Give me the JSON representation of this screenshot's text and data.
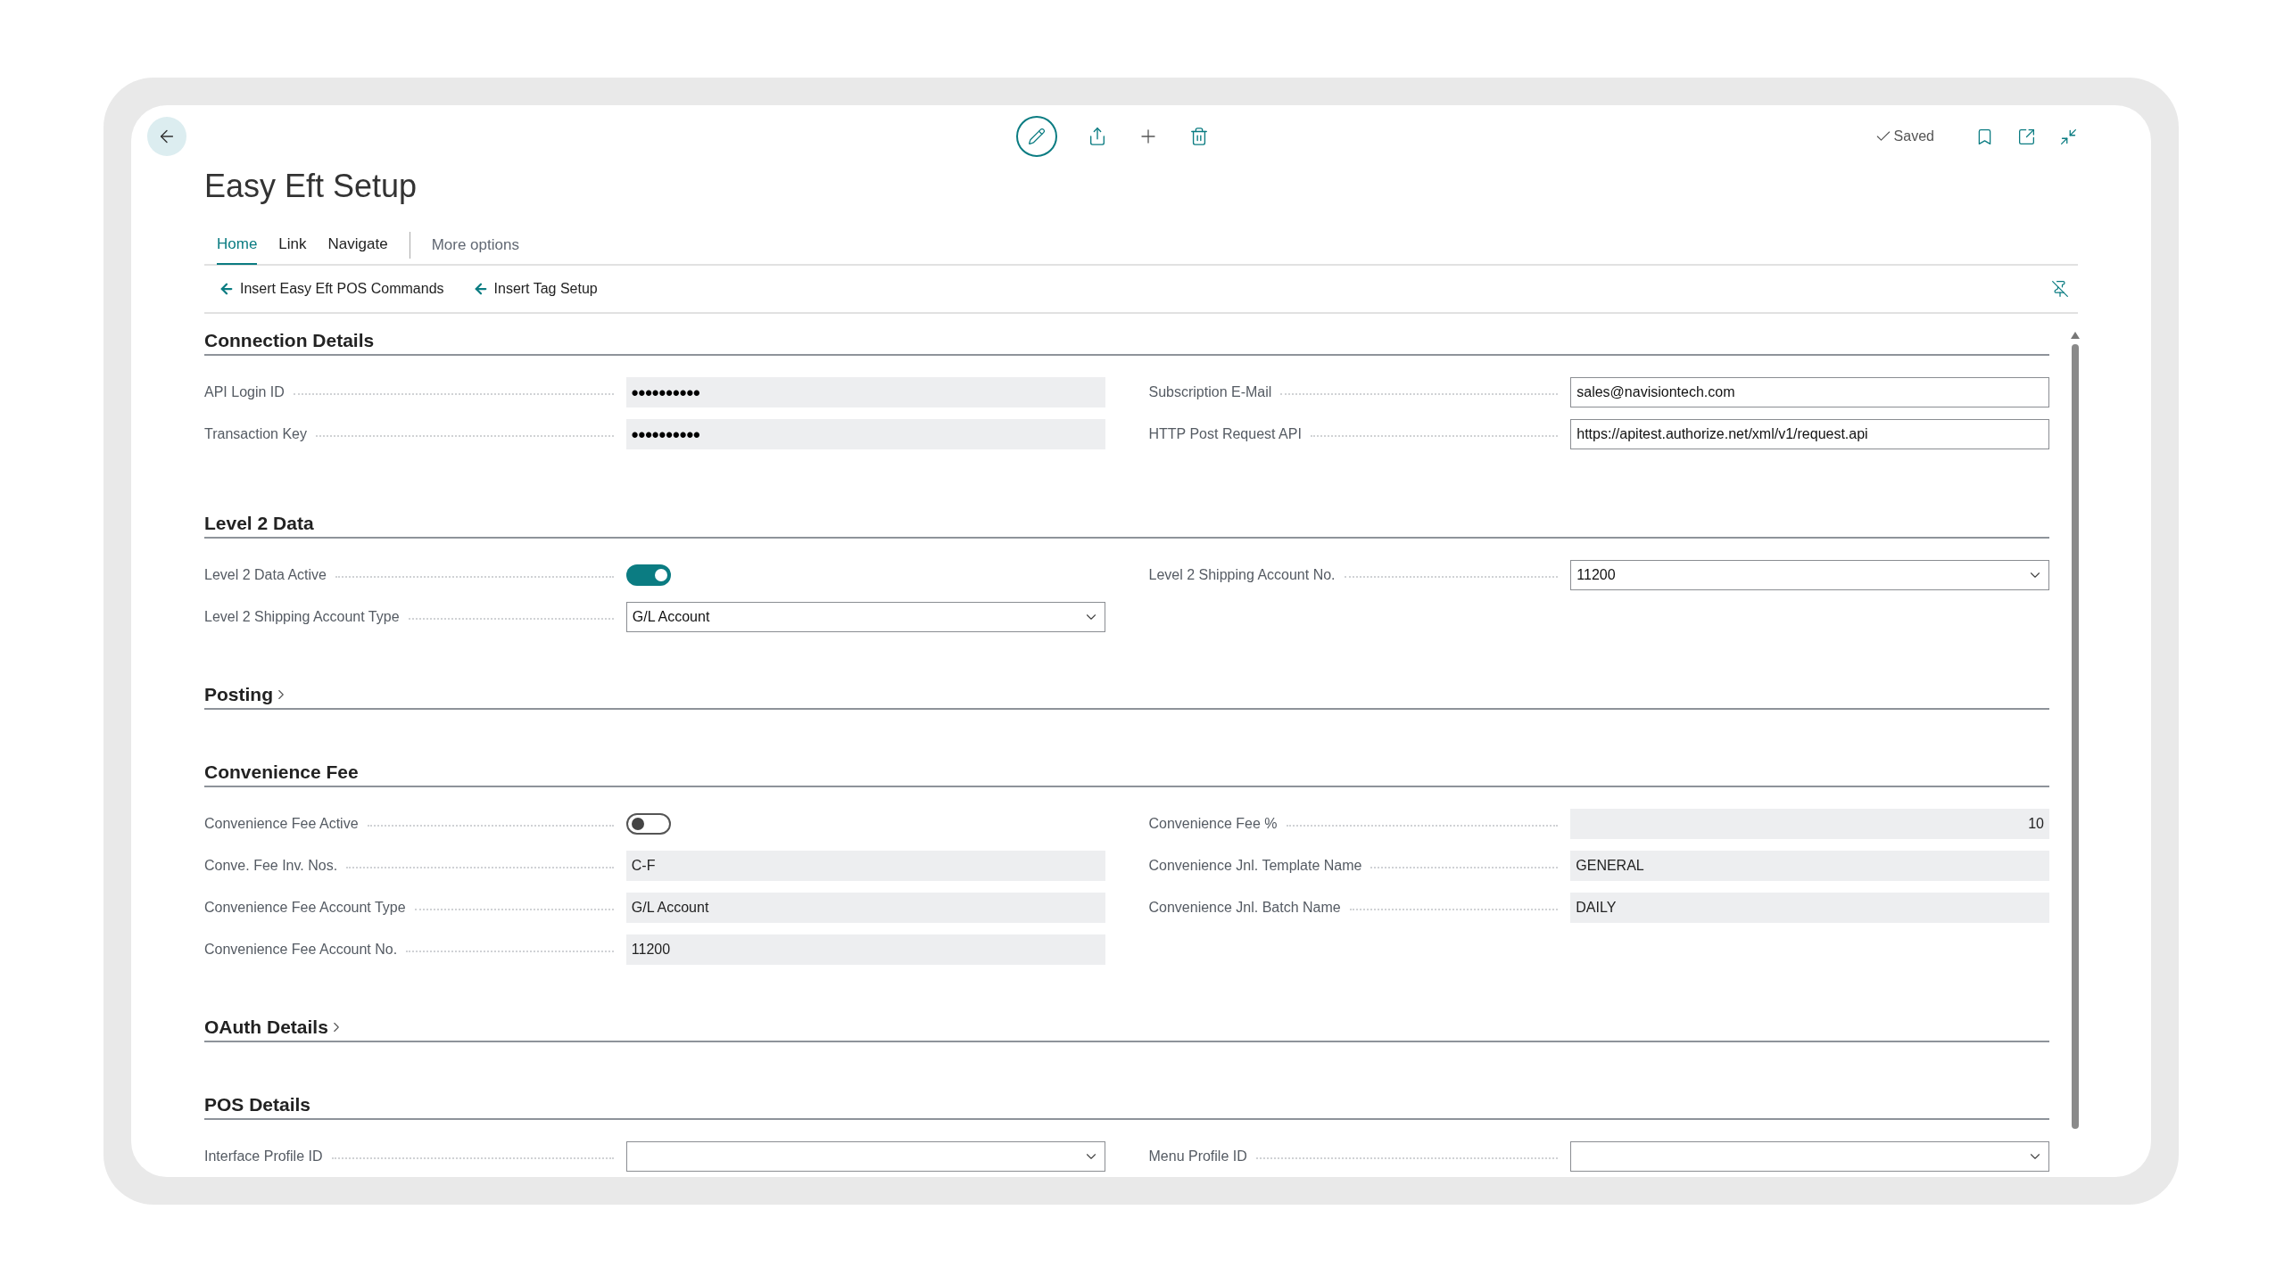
{
  "toolbar": {
    "saved": "Saved"
  },
  "title": "Easy Eft Setup",
  "tabs": [
    {
      "label": "Home",
      "selected": true
    },
    {
      "label": "Link",
      "selected": false
    },
    {
      "label": "Navigate",
      "selected": false
    }
  ],
  "more_options": "More options",
  "actions": [
    "Insert Easy Eft POS Commands",
    "Insert Tag Setup"
  ],
  "sections": [
    {
      "title": "Connection Details",
      "expanded": true,
      "left": [
        {
          "label": "API Login ID",
          "kind": "masked",
          "value": "••••••••••"
        },
        {
          "label": "Transaction Key",
          "kind": "masked",
          "value": "••••••••••"
        }
      ],
      "right": [
        {
          "label": "Subscription E-Mail",
          "kind": "text",
          "value": "sales@navisiontech.com"
        },
        {
          "label": "HTTP Post Request API",
          "kind": "text",
          "value": "https://apitest.authorize.net/xml/v1/request.api"
        }
      ]
    },
    {
      "title": "Level 2 Data",
      "expanded": true,
      "left": [
        {
          "label": "Level 2 Data Active",
          "kind": "toggle",
          "on": true
        },
        {
          "label": "Level 2 Shipping Account Type",
          "kind": "dropdown",
          "value": "G/L Account"
        }
      ],
      "right": [
        {
          "label": "Level 2 Shipping Account No.",
          "kind": "dropdown",
          "value": "11200"
        }
      ]
    },
    {
      "title": "Posting",
      "expanded": false
    },
    {
      "title": "Convenience Fee",
      "expanded": true,
      "left": [
        {
          "label": "Convenience Fee Active",
          "kind": "toggle",
          "on": false
        },
        {
          "label": "Conve. Fee Inv. Nos.",
          "kind": "readonly",
          "value": "C-F"
        },
        {
          "label": "Convenience Fee Account Type",
          "kind": "readonly",
          "value": "G/L Account"
        },
        {
          "label": "Convenience Fee Account No.",
          "kind": "readonly",
          "value": "11200"
        }
      ],
      "right": [
        {
          "label": "Convenience Fee %",
          "kind": "readonly_number",
          "value": "10"
        },
        {
          "label": "Convenience Jnl. Template Name",
          "kind": "readonly",
          "value": "GENERAL"
        },
        {
          "label": "Convenience Jnl. Batch Name",
          "kind": "readonly",
          "value": "DAILY"
        }
      ]
    },
    {
      "title": "OAuth Details",
      "expanded": false
    },
    {
      "title": "POS Details",
      "expanded": true,
      "left": [
        {
          "label": "Interface Profile ID",
          "kind": "dropdown"
        }
      ],
      "right": [
        {
          "label": "Menu Profile ID",
          "kind": "dropdown"
        }
      ]
    }
  ]
}
